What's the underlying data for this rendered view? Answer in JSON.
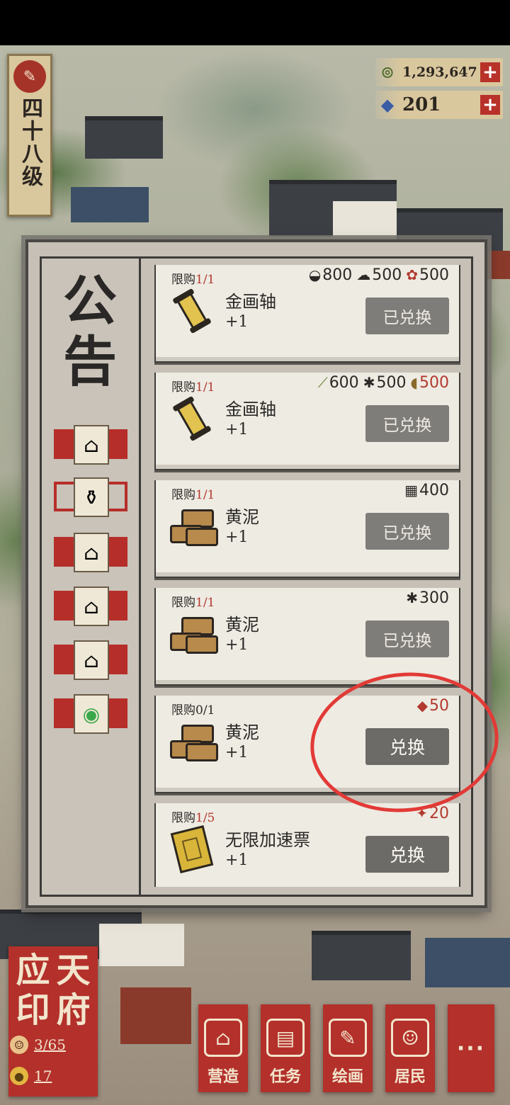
{
  "hud": {
    "level": "四十八级",
    "coins": "1,293,647",
    "gems": "201",
    "plus": "+"
  },
  "panel": {
    "title": "公告",
    "tabs": [
      {
        "icon": "house-icon"
      },
      {
        "icon": "bottle-icon",
        "active": true
      },
      {
        "icon": "house-icon"
      },
      {
        "icon": "house-icon"
      },
      {
        "icon": "house-icon"
      },
      {
        "icon": "chat-icon"
      }
    ]
  },
  "items": [
    {
      "limit_label": "限购",
      "limit": "1/1",
      "costs": [
        {
          "icon": "bowl-icon",
          "value": "800",
          "red": false
        },
        {
          "icon": "cloud-icon",
          "value": "500",
          "red": false
        },
        {
          "icon": "flower-icon",
          "value": "500",
          "red": false
        }
      ],
      "name": "金画轴",
      "qty": "+1",
      "icon": "scroll",
      "button": "已兑换",
      "active": false
    },
    {
      "limit_label": "限购",
      "limit": "1/1",
      "costs": [
        {
          "icon": "bamboo-icon",
          "value": "600",
          "red": false
        },
        {
          "icon": "leaf-icon",
          "value": "500",
          "red": false
        },
        {
          "icon": "fan-icon",
          "value": "500",
          "red": true
        }
      ],
      "name": "金画轴",
      "qty": "+1",
      "icon": "scroll",
      "button": "已兑换",
      "active": false
    },
    {
      "limit_label": "限购",
      "limit": "1/1",
      "costs": [
        {
          "icon": "net-icon",
          "value": "400",
          "red": false
        }
      ],
      "name": "黄泥",
      "qty": "+1",
      "icon": "mud",
      "button": "已兑换",
      "active": false
    },
    {
      "limit_label": "限购",
      "limit": "1/1",
      "costs": [
        {
          "icon": "leaf-icon",
          "value": "300",
          "red": false
        }
      ],
      "name": "黄泥",
      "qty": "+1",
      "icon": "mud",
      "button": "已兑换",
      "active": false
    },
    {
      "limit_label": "限购",
      "limit": "0/1",
      "costs": [
        {
          "icon": "red-token-icon",
          "value": "50",
          "red": true
        }
      ],
      "name": "黄泥",
      "qty": "+1",
      "icon": "mud",
      "button": "兑换",
      "active": true
    },
    {
      "limit_label": "限购",
      "limit": "1/5",
      "costs": [
        {
          "icon": "pin-icon",
          "value": "20",
          "red": true
        }
      ],
      "name": "无限加速票",
      "qty": "+1",
      "icon": "ticket",
      "button": "兑换",
      "active": true
    }
  ],
  "seal": {
    "chars": [
      "应",
      "天",
      "府",
      "印"
    ],
    "residents": "3/65",
    "gold": "17"
  },
  "nav": {
    "build": "营造",
    "task": "任务",
    "paint": "绘画",
    "resident": "居民",
    "more": "···"
  },
  "colors": {
    "accent_red": "#b3302b",
    "panel_bg": "#c6c0b6",
    "item_bg": "#eeebe3",
    "button_gray": "#7f7d7a",
    "annotation": "#e23a36"
  }
}
